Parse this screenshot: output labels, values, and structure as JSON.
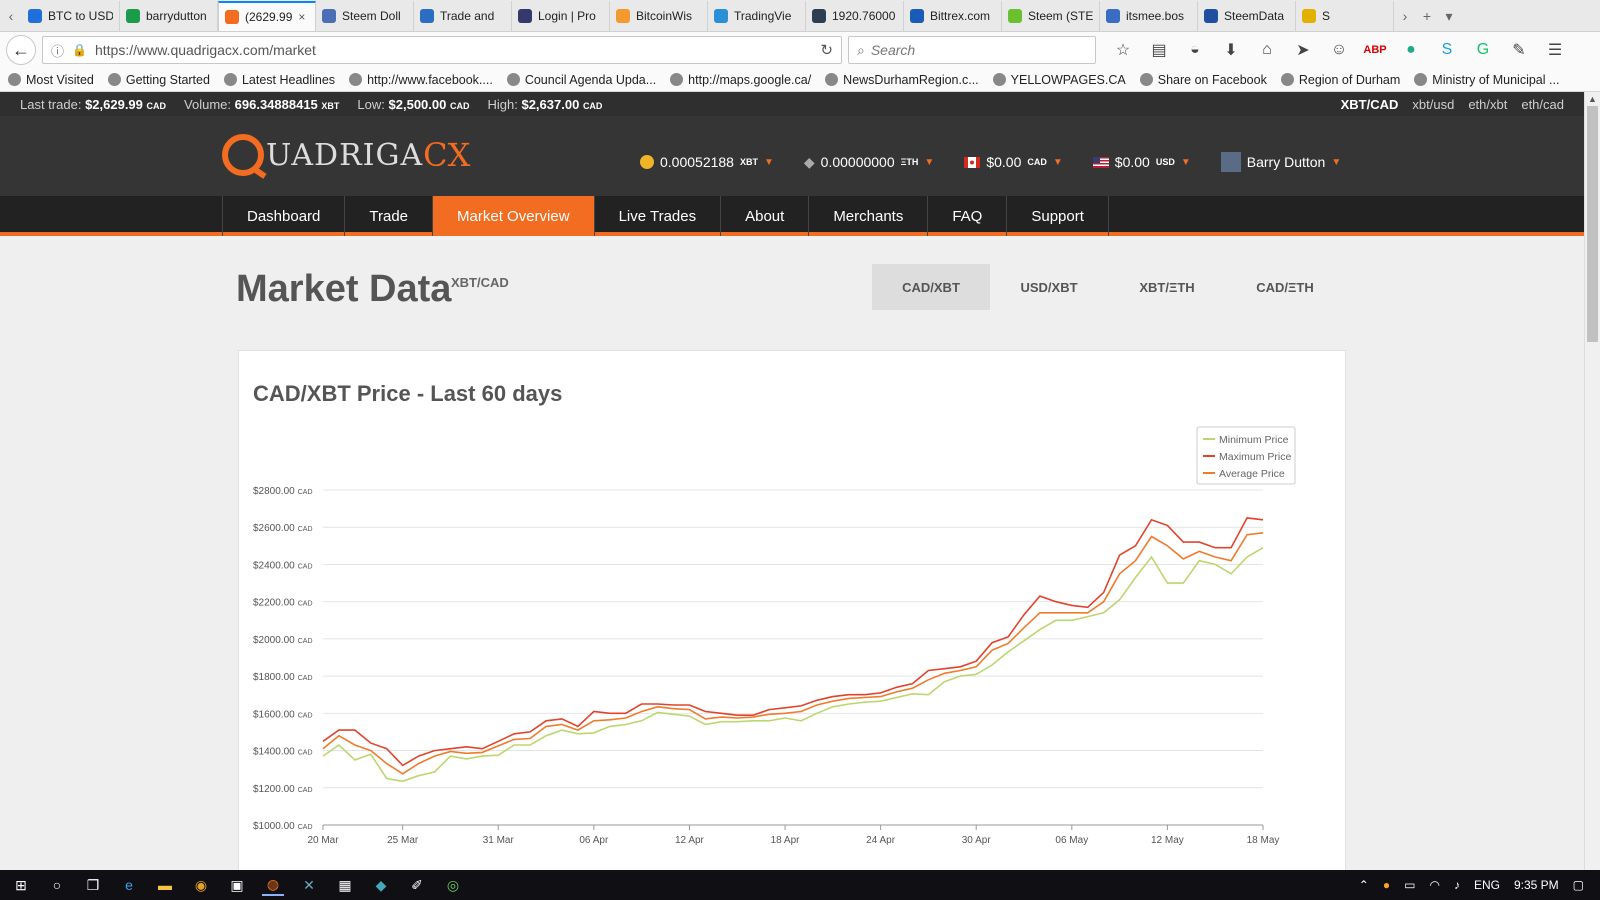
{
  "browser": {
    "tabs": [
      {
        "label": "BTC to USD",
        "color": "#1e6fd9"
      },
      {
        "label": "barrydutton",
        "color": "#1a9c4a"
      },
      {
        "label": "(2629.99",
        "color": "#f26c21",
        "active": true
      },
      {
        "label": "Steem Doll",
        "color": "#4a6fb5"
      },
      {
        "label": "Trade and",
        "color": "#2b6cc4"
      },
      {
        "label": "Login | Pro",
        "color": "#333a6b"
      },
      {
        "label": "BitcoinWis",
        "color": "#f29a2e"
      },
      {
        "label": "TradingVie",
        "color": "#2a8fd6"
      },
      {
        "label": "1920.76000",
        "color": "#2c3e50"
      },
      {
        "label": "Bittrex.com",
        "color": "#1a5bb8"
      },
      {
        "label": "Steem (STE",
        "color": "#6cbf2f"
      },
      {
        "label": "itsmee.bos",
        "color": "#3a6dc2"
      },
      {
        "label": "SteemData",
        "color": "#1e4fa0"
      },
      {
        "label": "S",
        "color": "#e4b000"
      }
    ],
    "url": "https://www.quadrigacx.com/market",
    "search_placeholder": "Search",
    "bookmarks": [
      "Most Visited",
      "Getting Started",
      "Latest Headlines",
      "http://www.facebook....",
      "Council Agenda Upda...",
      "http://maps.google.ca/",
      "NewsDurhamRegion.c...",
      "YELLOWPAGES.CA",
      "Share on Facebook",
      "Region of Durham",
      "Ministry of Municipal ..."
    ]
  },
  "ticker": {
    "last_trade_label": "Last trade:",
    "last_trade": "$2,629.99",
    "last_trade_unit": "CAD",
    "volume_label": "Volume:",
    "volume": "696.34888415",
    "volume_unit": "XBT",
    "low_label": "Low:",
    "low": "$2,500.00",
    "low_unit": "CAD",
    "high_label": "High:",
    "high": "$2,637.00",
    "high_unit": "CAD",
    "pairs": [
      "XBT/CAD",
      "xbt/usd",
      "eth/xbt",
      "eth/cad"
    ]
  },
  "header": {
    "logo_text": "UADRIGA",
    "logo_cx": "CX",
    "balances": [
      {
        "value": "0.00052188",
        "unit": "XBT"
      },
      {
        "value": "0.00000000",
        "unit": "ΞTH"
      },
      {
        "value": "$0.00",
        "unit": "CAD"
      },
      {
        "value": "$0.00",
        "unit": "USD"
      }
    ],
    "user": "Barry Dutton"
  },
  "nav": [
    "Dashboard",
    "Trade",
    "Market Overview",
    "Live Trades",
    "About",
    "Merchants",
    "FAQ",
    "Support"
  ],
  "page": {
    "title": "Market Data",
    "subtitle": "XBT/CAD",
    "pair_tabs": [
      "CAD/XBT",
      "USD/XBT",
      "XBT/ΞTH",
      "CAD/ΞTH"
    ]
  },
  "chart_data": {
    "type": "line",
    "title": "CAD/XBT Price - Last 60 days",
    "x": [
      "20 Mar",
      "21 Mar",
      "22 Mar",
      "23 Mar",
      "24 Mar",
      "25 Mar",
      "26 Mar",
      "27 Mar",
      "28 Mar",
      "29 Mar",
      "30 Mar",
      "31 Mar",
      "01 Apr",
      "02 Apr",
      "03 Apr",
      "04 Apr",
      "05 Apr",
      "06 Apr",
      "07 Apr",
      "08 Apr",
      "09 Apr",
      "10 Apr",
      "11 Apr",
      "12 Apr",
      "13 Apr",
      "14 Apr",
      "15 Apr",
      "16 Apr",
      "17 Apr",
      "18 Apr",
      "19 Apr",
      "20 Apr",
      "21 Apr",
      "22 Apr",
      "23 Apr",
      "24 Apr",
      "25 Apr",
      "26 Apr",
      "27 Apr",
      "28 Apr",
      "29 Apr",
      "30 Apr",
      "01 May",
      "02 May",
      "03 May",
      "04 May",
      "05 May",
      "06 May",
      "07 May",
      "08 May",
      "09 May",
      "10 May",
      "11 May",
      "12 May",
      "13 May",
      "14 May",
      "15 May",
      "16 May",
      "17 May",
      "18 May"
    ],
    "xticks": [
      "20 Mar",
      "25 Mar",
      "31 Mar",
      "06 Apr",
      "12 Apr",
      "18 Apr",
      "24 Apr",
      "30 Apr",
      "06 May",
      "12 May",
      "18 May"
    ],
    "yticks": [
      "$1000.00",
      "$1200.00",
      "$1400.00",
      "$1600.00",
      "$1800.00",
      "$2000.00",
      "$2200.00",
      "$2400.00",
      "$2600.00",
      "$2800.00"
    ],
    "ytick_unit": "CAD",
    "ylim": [
      1000,
      2800
    ],
    "series": [
      {
        "name": "Minimum Price",
        "color": "#bcd66f",
        "values": [
          1370,
          1430,
          1350,
          1380,
          1250,
          1235,
          1265,
          1285,
          1370,
          1355,
          1370,
          1375,
          1430,
          1430,
          1480,
          1510,
          1490,
          1495,
          1530,
          1540,
          1560,
          1605,
          1595,
          1585,
          1540,
          1555,
          1555,
          1560,
          1560,
          1575,
          1560,
          1600,
          1635,
          1650,
          1660,
          1665,
          1685,
          1705,
          1700,
          1770,
          1800,
          1810,
          1860,
          1930,
          1990,
          2050,
          2100,
          2100,
          2120,
          2140,
          2210,
          2330,
          2440,
          2300,
          2300,
          2420,
          2400,
          2350,
          2440,
          2490
        ]
      },
      {
        "name": "Maximum Price",
        "color": "#e2432c",
        "values": [
          1450,
          1510,
          1510,
          1440,
          1410,
          1320,
          1370,
          1400,
          1410,
          1420,
          1410,
          1450,
          1490,
          1500,
          1560,
          1570,
          1530,
          1610,
          1600,
          1600,
          1650,
          1650,
          1645,
          1645,
          1610,
          1600,
          1590,
          1590,
          1620,
          1630,
          1640,
          1670,
          1690,
          1700,
          1700,
          1710,
          1740,
          1760,
          1830,
          1840,
          1850,
          1880,
          1980,
          2010,
          2130,
          2230,
          2200,
          2180,
          2170,
          2250,
          2450,
          2500,
          2640,
          2610,
          2520,
          2520,
          2490,
          2490,
          2650,
          2640
        ]
      },
      {
        "name": "Average Price",
        "color": "#f07b2b",
        "values": [
          1410,
          1480,
          1430,
          1400,
          1330,
          1275,
          1330,
          1370,
          1395,
          1385,
          1390,
          1425,
          1460,
          1465,
          1530,
          1540,
          1510,
          1560,
          1565,
          1575,
          1610,
          1635,
          1625,
          1620,
          1570,
          1580,
          1575,
          1580,
          1595,
          1600,
          1610,
          1645,
          1665,
          1680,
          1685,
          1690,
          1715,
          1735,
          1780,
          1815,
          1830,
          1850,
          1940,
          1975,
          2060,
          2140,
          2140,
          2140,
          2140,
          2200,
          2350,
          2420,
          2550,
          2500,
          2430,
          2470,
          2440,
          2420,
          2560,
          2570
        ]
      }
    ],
    "legend_position": "top-right",
    "grid": true
  },
  "taskbar": {
    "lang": "ENG",
    "time": "9:35 PM"
  }
}
